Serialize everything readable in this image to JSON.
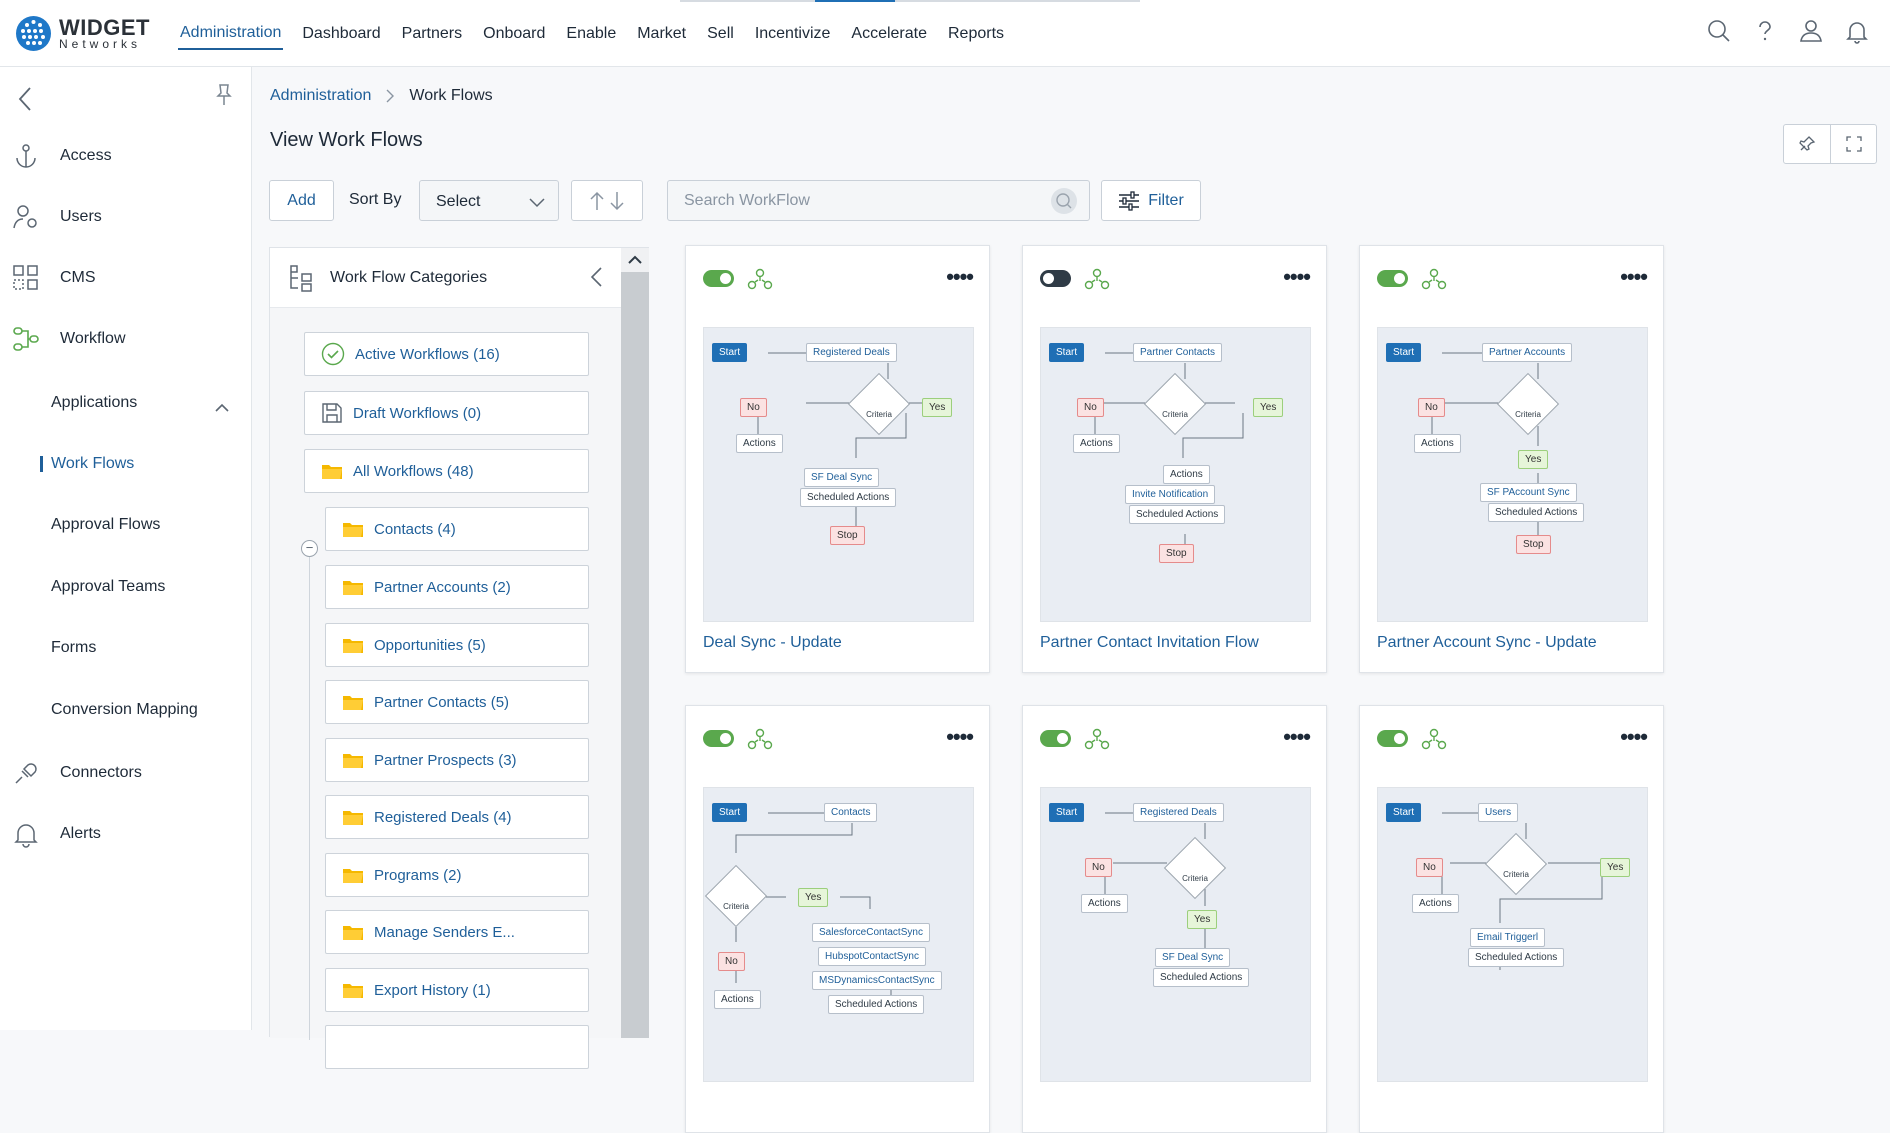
{
  "brand": {
    "name": "WIDGET",
    "sub": "Networks"
  },
  "main_nav": [
    "Administration",
    "Dashboard",
    "Partners",
    "Onboard",
    "Enable",
    "Market",
    "Sell",
    "Incentivize",
    "Accelerate",
    "Reports"
  ],
  "sidebar": {
    "items": [
      {
        "label": "Access",
        "icon": "anchor-icon"
      },
      {
        "label": "Users",
        "icon": "users-gear-icon"
      },
      {
        "label": "CMS",
        "icon": "cms-grid-icon"
      },
      {
        "label": "Workflow",
        "icon": "workflow-icon"
      },
      {
        "label": "Connectors",
        "icon": "plug-icon"
      },
      {
        "label": "Alerts",
        "icon": "bell-icon"
      }
    ],
    "workflow_sub": [
      "Applications",
      "Work Flows",
      "Approval Flows",
      "Approval Teams",
      "Forms",
      "Conversion Mapping"
    ],
    "active_sub": "Work Flows"
  },
  "breadcrumb": {
    "root": "Administration",
    "current": "Work Flows"
  },
  "page_title": "View Work Flows",
  "toolbar": {
    "add": "Add",
    "sort_by": "Sort By",
    "select": "Select",
    "search_placeholder": "Search WorkFlow",
    "filter": "Filter"
  },
  "categories": {
    "title": "Work Flow Categories",
    "items": [
      "Active Workflows (16)",
      "Draft Workflows (0)",
      "All Workflows (48)",
      "Contacts (4)",
      "Partner Accounts (2)",
      "Opportunities (5)",
      "Partner Contacts (5)",
      "Partner Prospects (3)",
      "Registered Deals (4)",
      "Programs (2)",
      "Manage Senders E...",
      "Export History (1)"
    ]
  },
  "workflows": [
    {
      "name": "Deal Sync - Update",
      "active": true,
      "nodes": {
        "start": "Start",
        "object": "Registered Deals",
        "no": "No",
        "criteria": "Criteria",
        "yes": "Yes",
        "actions": "Actions",
        "sync": "SF Deal Sync",
        "scheduled": "Scheduled Actions",
        "stop": "Stop"
      }
    },
    {
      "name": "Partner Contact Invitation Flow",
      "active": false,
      "nodes": {
        "start": "Start",
        "object": "Partner Contacts",
        "no": "No",
        "criteria": "Criteria",
        "yes": "Yes",
        "actions": "Actions",
        "actions2": "Actions",
        "sync": "Invite Notification",
        "scheduled": "Scheduled Actions",
        "stop": "Stop"
      }
    },
    {
      "name": "Partner Account Sync - Update",
      "active": true,
      "nodes": {
        "start": "Start",
        "object": "Partner Accounts",
        "no": "No",
        "criteria": "Criteria",
        "yes": "Yes",
        "actions": "Actions",
        "sync": "SF PAccount Sync",
        "scheduled": "Scheduled Actions",
        "stop": "Stop"
      }
    },
    {
      "name": "",
      "active": true,
      "nodes": {
        "start": "Start",
        "object": "Contacts",
        "criteria": "Criteria",
        "yes": "Yes",
        "no": "No",
        "actions": "Actions",
        "sync": "SalesforceContactSync",
        "sync2": "HubspotContactSync",
        "sync3": "MSDynamicsContactSync",
        "scheduled": "Scheduled Actions"
      }
    },
    {
      "name": "",
      "active": true,
      "nodes": {
        "start": "Start",
        "object": "Registered Deals",
        "no": "No",
        "criteria": "Criteria",
        "yes": "Yes",
        "actions": "Actions",
        "sync": "SF Deal Sync",
        "scheduled": "Scheduled Actions"
      }
    },
    {
      "name": "",
      "active": true,
      "nodes": {
        "start": "Start",
        "object": "Users",
        "no": "No",
        "criteria": "Criteria",
        "yes": "Yes",
        "actions": "Actions",
        "sync": "Email Triggerl",
        "scheduled": "Scheduled Actions"
      }
    }
  ]
}
